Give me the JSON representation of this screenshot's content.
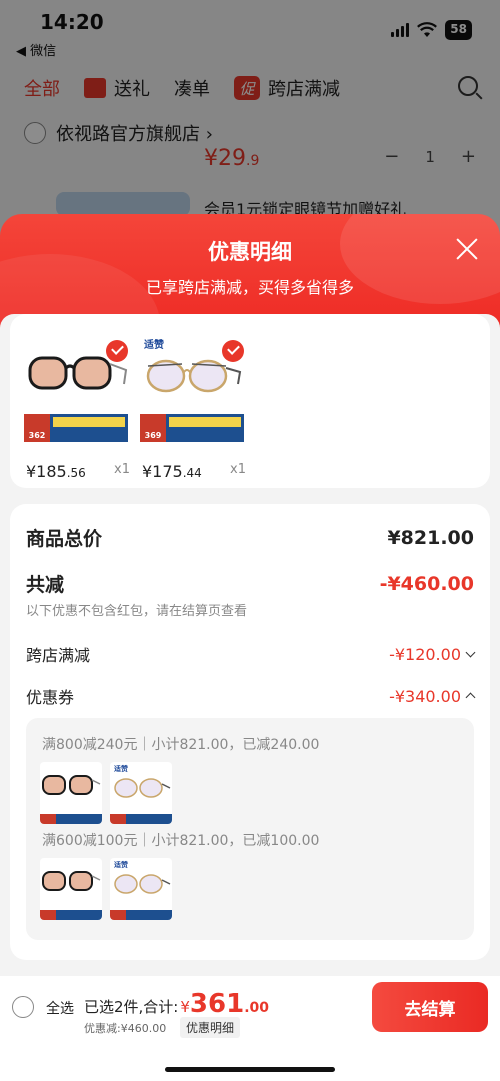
{
  "status_bar": {
    "time": "14:20",
    "back_app": "◀ 微信",
    "battery": "58"
  },
  "bg_page": {
    "tabs": [
      {
        "label": "全部",
        "active": true
      },
      {
        "label": "送礼",
        "icon": "gift-icon"
      },
      {
        "label": "凑单"
      },
      {
        "label": "跨店满减",
        "icon": "promo-icon",
        "icon_text": "促"
      }
    ],
    "store_name": "依视路官方旗舰店 ›",
    "price_int": "¥29",
    "price_dec": ".9",
    "stepper": {
      "minus": "−",
      "qty": "1",
      "plus": "+"
    },
    "promo_tip": "会员1元锁定眼镜节加赠好礼"
  },
  "sheet": {
    "title": "优惠明细",
    "subtitle": "已享跨店满减，买得多省得多"
  },
  "products": [
    {
      "brand": "",
      "tag_price": "362",
      "price_int": "¥185",
      "price_dec": ".56",
      "qty": "x1",
      "checked": true,
      "frame": "#1a1a1a",
      "lens": "#e8b8a0"
    },
    {
      "brand": "适赞",
      "tag_price": "369",
      "price_int": "¥175",
      "price_dec": ".44",
      "qty": "x1",
      "checked": true,
      "frame": "#c9a66b",
      "lens": "#ece6f4"
    }
  ],
  "summary": {
    "total_label": "商品总价",
    "total_value": "¥821.00",
    "reduce_label": "共减",
    "reduce_value": "-¥460.00",
    "note": "以下优惠不包含红包，请在结算页查看",
    "cross_store_label": "跨店满减",
    "cross_store_value": "-¥120.00",
    "coupon_label": "优惠券",
    "coupon_value": "-¥340.00"
  },
  "coupons": [
    {
      "text": "满800减240元｜小计821.00，已减240.00"
    },
    {
      "text": "满600减100元｜小计821.00，已减100.00"
    }
  ],
  "bottom_bar": {
    "select_all": "全选",
    "selected_text": "已选2件,合计:",
    "currency": "¥",
    "total_int": "361",
    "total_dec": ".00",
    "discount_text": "优惠减:¥460.00",
    "detail_label": "优惠明细",
    "checkout_label": "去结算"
  },
  "colors": {
    "accent": "#e8372a",
    "header": "#f0302a"
  }
}
